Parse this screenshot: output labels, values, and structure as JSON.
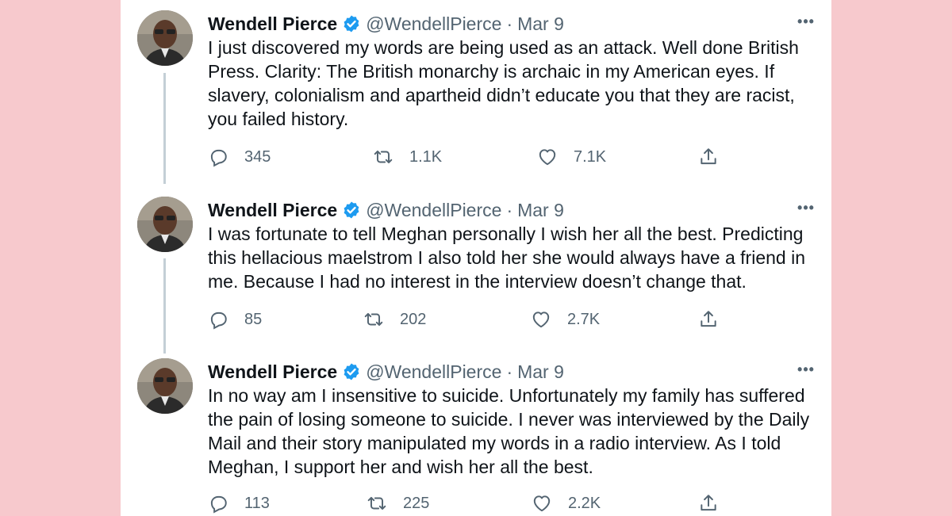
{
  "tweets": [
    {
      "name": "Wendell Pierce",
      "handle": "@WendellPierce",
      "separator": "·",
      "date": "Mar 9",
      "more": "•••",
      "text": "I just discovered my words are being used as an attack. Well done British Press. Clarity: The British monarchy is archaic in my American eyes. If slavery, colonialism and apartheid didn’t educate you that they are racist, you failed history.",
      "replies": "345",
      "retweets": "1.1K",
      "likes": "7.1K"
    },
    {
      "name": "Wendell Pierce",
      "handle": "@WendellPierce",
      "separator": "·",
      "date": "Mar 9",
      "more": "•••",
      "text": "I was fortunate to tell Meghan personally I wish her all the best. Predicting this hellacious maelstrom I also told her she would always have a friend in me. Because I had no interest in the interview doesn’t change that.",
      "replies": "85",
      "retweets": "202",
      "likes": "2.7K"
    },
    {
      "name": "Wendell Pierce",
      "handle": "@WendellPierce",
      "separator": "·",
      "date": "Mar 9",
      "more": "•••",
      "text": "In no way am I insensitive to suicide. Unfortunately my family has suffered the pain of losing someone to suicide. I never was interviewed by the Daily Mail and their story manipulated my words in a radio interview. As I told Meghan, I support her and wish her all the best.",
      "replies": "113",
      "retweets": "225",
      "likes": "2.2K"
    }
  ],
  "icons": {
    "verified": "verified-badge-icon",
    "reply": "reply-icon",
    "retweet": "retweet-icon",
    "like": "heart-icon",
    "share": "share-icon",
    "more": "more-icon"
  },
  "colors": {
    "page_background": "#f7c9cd",
    "card_background": "#ffffff",
    "verified_blue": "#1d9bf0",
    "text": "#0f1419",
    "muted": "#536471",
    "thread_line": "#c4cfd6"
  }
}
